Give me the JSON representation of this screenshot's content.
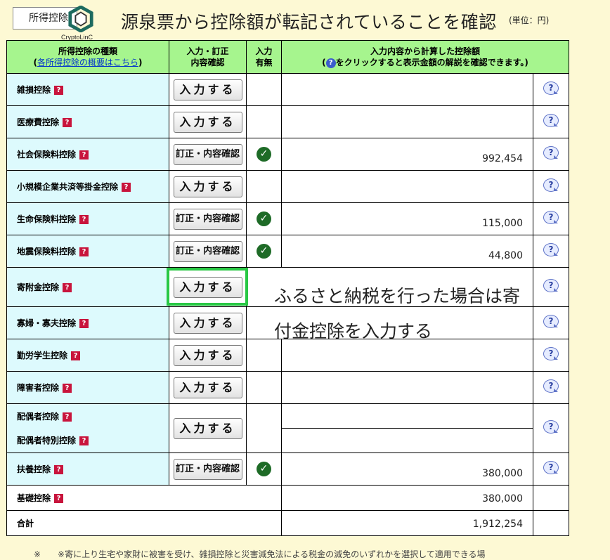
{
  "header": {
    "tab_label": "所得控除",
    "logo_text": "CryptoLinC",
    "title": "源泉票から控除額が転記されていることを確認",
    "unit": "(単位：円)"
  },
  "table": {
    "col_type": "所得控除の種類",
    "col_type_link": "各所得控除の概要はこちら",
    "col_action_1": "入力・訂正",
    "col_action_2": "内容確認",
    "col_flag_1": "入力",
    "col_flag_2": "有無",
    "col_amount_1": "入力内容から計算した控除額",
    "col_amount_2a": "(",
    "col_amount_2b": "をクリックすると表示金額の解説を確認できます。)",
    "rows": [
      {
        "name": "雑損控除",
        "button": "入力する",
        "value": ""
      },
      {
        "name": "医療費控除",
        "button": "入力する",
        "value": ""
      },
      {
        "name": "社会保険料控除",
        "button": "訂正・内容確認",
        "value": "992,454"
      },
      {
        "name": "小規模企業共済等掛金控除",
        "button": "入力する",
        "value": ""
      },
      {
        "name": "生命保険料控除",
        "button": "訂正・内容確認",
        "value": "115,000"
      },
      {
        "name": "地震保険料控除",
        "button": "訂正・内容確認",
        "value": "44,800"
      },
      {
        "name": "寄附金控除",
        "button": "入力する",
        "value": ""
      },
      {
        "name": "寡婦・寡夫控除",
        "button": "入力する",
        "value": ""
      },
      {
        "name": "勤労学生控除",
        "button": "入力する",
        "value": ""
      },
      {
        "name": "障害者控除",
        "button": "入力する",
        "value": ""
      },
      {
        "name": "配偶者控除",
        "button": "入力する",
        "value": ""
      },
      {
        "name": "配偶者特別控除",
        "button": "",
        "value": ""
      },
      {
        "name": "扶養控除",
        "button": "訂正・内容確認",
        "value": "380,000"
      },
      {
        "name": "基礎控除",
        "button": "",
        "value": "380,000"
      },
      {
        "name": "合計",
        "button": "",
        "value": "1,912,254"
      }
    ]
  },
  "annotation": {
    "line1": "ふるさと納税を行った場合は寄",
    "line2": "付金控除を入力する"
  },
  "footer": "※　　※寄に上り生宅や家財に被害を受け、雑損控除と災害減免法による税金の減免のいずれかを選択して適用できる場",
  "icons": {
    "help": "question-bubble-icon",
    "check": "check-circle-icon",
    "info": "question-mark-icon"
  },
  "colors": {
    "header_bg": "#a6f58e",
    "name_bg": "#ddfafd",
    "page_bg": "#fdf9d4",
    "highlight": "#29c845",
    "check": "#1e6b27",
    "qmark": "#c8143c"
  }
}
